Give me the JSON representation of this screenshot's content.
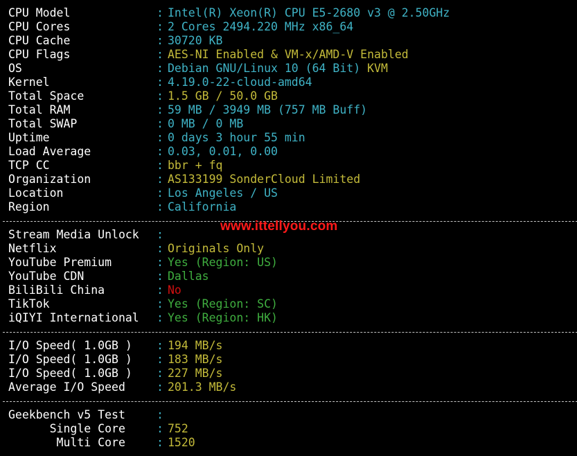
{
  "system": {
    "rows": [
      {
        "label": "CPU Model",
        "segments": [
          {
            "text": "Intel(R) Xeon(R) CPU E5-2680 v3 @ 2.50GHz",
            "color": "cyan"
          }
        ]
      },
      {
        "label": "CPU Cores",
        "segments": [
          {
            "text": "2 Cores 2494.220 MHz x86_64",
            "color": "cyan"
          }
        ]
      },
      {
        "label": "CPU Cache",
        "segments": [
          {
            "text": "30720 KB",
            "color": "cyan"
          }
        ]
      },
      {
        "label": "CPU Flags",
        "segments": [
          {
            "text": "AES-NI Enabled & VM-x/AMD-V Enabled",
            "color": "yellow"
          }
        ]
      },
      {
        "label": "OS",
        "segments": [
          {
            "text": "Debian GNU/Linux 10 (64 Bit) ",
            "color": "cyan"
          },
          {
            "text": "KVM",
            "color": "yellow"
          }
        ]
      },
      {
        "label": "Kernel",
        "segments": [
          {
            "text": "4.19.0-22-cloud-amd64",
            "color": "cyan"
          }
        ]
      },
      {
        "label": "Total Space",
        "segments": [
          {
            "text": "1.5 GB / 50.0 GB",
            "color": "yellow"
          }
        ]
      },
      {
        "label": "Total RAM",
        "segments": [
          {
            "text": "59 MB / 3949 MB (757 MB Buff)",
            "color": "cyan"
          }
        ]
      },
      {
        "label": "Total SWAP",
        "segments": [
          {
            "text": "0 MB / 0 MB",
            "color": "cyan"
          }
        ]
      },
      {
        "label": "Uptime",
        "segments": [
          {
            "text": "0 days 3 hour 55 min",
            "color": "cyan"
          }
        ]
      },
      {
        "label": "Load Average",
        "segments": [
          {
            "text": "0.03, 0.01, 0.00",
            "color": "cyan"
          }
        ]
      },
      {
        "label": "TCP CC",
        "segments": [
          {
            "text": "bbr + fq",
            "color": "yellow"
          }
        ]
      },
      {
        "label": "Organization",
        "segments": [
          {
            "text": "AS133199 SonderCloud Limited",
            "color": "yellow"
          }
        ]
      },
      {
        "label": "Location",
        "segments": [
          {
            "text": "Los Angeles / US",
            "color": "cyan"
          }
        ]
      },
      {
        "label": "Region",
        "segments": [
          {
            "text": "California",
            "color": "cyan"
          }
        ]
      }
    ]
  },
  "media": {
    "rows": [
      {
        "label": "Stream Media Unlock",
        "segments": []
      },
      {
        "label": "Netflix",
        "segments": [
          {
            "text": "Originals Only",
            "color": "yellow"
          }
        ]
      },
      {
        "label": "YouTube Premium",
        "segments": [
          {
            "text": "Yes (Region: US)",
            "color": "green"
          }
        ]
      },
      {
        "label": "YouTube CDN",
        "segments": [
          {
            "text": "Dallas",
            "color": "green"
          }
        ]
      },
      {
        "label": "BiliBili China",
        "segments": [
          {
            "text": "No",
            "color": "red"
          }
        ]
      },
      {
        "label": "TikTok",
        "segments": [
          {
            "text": "Yes (Region: SC)",
            "color": "green"
          }
        ]
      },
      {
        "label": "iQIYI International",
        "segments": [
          {
            "text": "Yes (Region: HK)",
            "color": "green"
          }
        ]
      }
    ]
  },
  "io": {
    "rows": [
      {
        "label": "I/O Speed( 1.0GB )",
        "segments": [
          {
            "text": "194 MB/s",
            "color": "yellow"
          }
        ]
      },
      {
        "label": "I/O Speed( 1.0GB )",
        "segments": [
          {
            "text": "183 MB/s",
            "color": "yellow"
          }
        ]
      },
      {
        "label": "I/O Speed( 1.0GB )",
        "segments": [
          {
            "text": "227 MB/s",
            "color": "yellow"
          }
        ]
      },
      {
        "label": "Average I/O Speed",
        "segments": [
          {
            "text": "201.3 MB/s",
            "color": "yellow"
          }
        ]
      }
    ]
  },
  "geekbench": {
    "rows": [
      {
        "label": "Geekbench v5 Test",
        "segments": []
      },
      {
        "label": "      Single Core",
        "segments": [
          {
            "text": "752",
            "color": "yellow"
          }
        ]
      },
      {
        "label": "       Multi Core",
        "segments": [
          {
            "text": "1520",
            "color": "yellow"
          }
        ]
      }
    ]
  },
  "watermark": "www.ittellyou.com",
  "colors": {
    "cyan": "#3fb3c6",
    "yellow": "#c4bb3a",
    "green": "#3fae3f",
    "red": "#d01010",
    "label": "#ffffff",
    "background": "#000000"
  }
}
